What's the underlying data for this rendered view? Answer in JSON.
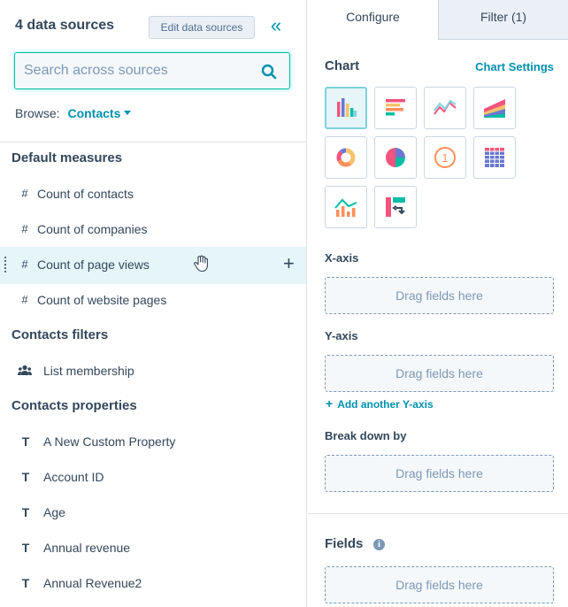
{
  "sources": {
    "title": "4 data sources",
    "edit_label": "Edit data sources",
    "search_placeholder": "Search across sources",
    "browse_label": "Browse:",
    "browse_value": "Contacts"
  },
  "sections": {
    "default_measures": "Default measures",
    "contacts_filters": "Contacts filters",
    "contacts_properties": "Contacts properties"
  },
  "measures": [
    {
      "icon": "#",
      "label": "Count of contacts"
    },
    {
      "icon": "#",
      "label": "Count of companies"
    },
    {
      "icon": "#",
      "label": "Count of page views"
    },
    {
      "icon": "#",
      "label": "Count of website pages"
    }
  ],
  "filters": [
    {
      "icon": "people-icon",
      "label": "List membership"
    }
  ],
  "properties": [
    {
      "icon": "T",
      "label": "A New Custom Property"
    },
    {
      "icon": "T",
      "label": "Account ID"
    },
    {
      "icon": "T",
      "label": "Age"
    },
    {
      "icon": "T",
      "label": "Annual revenue"
    },
    {
      "icon": "T",
      "label": "Annual Revenue2"
    }
  ],
  "tabs": [
    {
      "label": "Configure",
      "active": true
    },
    {
      "label": "Filter (1)",
      "active": false
    }
  ],
  "chart": {
    "title": "Chart",
    "settings_label": "Chart Settings",
    "types": [
      {
        "name": "vertical-bar",
        "selected": true
      },
      {
        "name": "horizontal-bar",
        "selected": false
      },
      {
        "name": "line",
        "selected": false
      },
      {
        "name": "area",
        "selected": false
      },
      {
        "name": "donut",
        "selected": false
      },
      {
        "name": "pie",
        "selected": false
      },
      {
        "name": "summary",
        "selected": false,
        "text": "1"
      },
      {
        "name": "table",
        "selected": false
      },
      {
        "name": "combination",
        "selected": false
      },
      {
        "name": "pivot",
        "selected": false
      }
    ]
  },
  "axes": {
    "x_label": "X-axis",
    "y_label": "Y-axis",
    "breakdown_label": "Break down by",
    "drop_text": "Drag fields here",
    "add_y_label": "Add another Y-axis"
  },
  "fields": {
    "title": "Fields",
    "info": "i",
    "drop_text": "Drag fields here"
  },
  "colors": {
    "accent": "#0091ae",
    "focus": "#00bda5",
    "text": "#33475b",
    "hover_row": "#e5f5f8"
  }
}
